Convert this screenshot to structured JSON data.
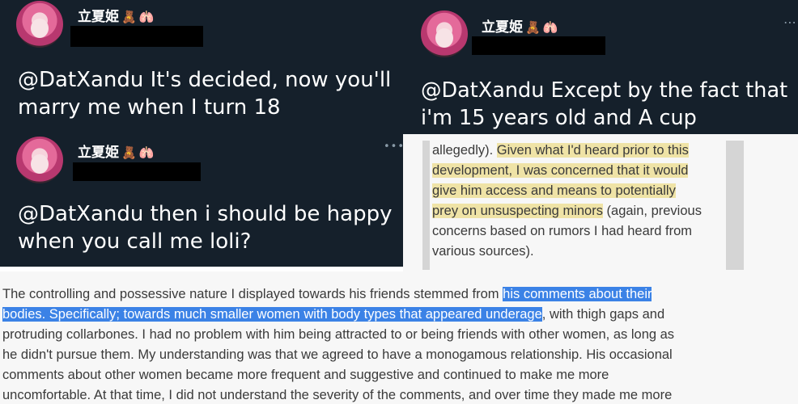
{
  "tweets": [
    {
      "username": "立夏姫",
      "emoji": [
        "🧸",
        "🫁"
      ],
      "text_lines": [
        "@DatXandu It's decided, now you'll",
        "marry me when I turn 18"
      ]
    },
    {
      "username": "立夏姫",
      "emoji": [
        "🧸",
        "🫁"
      ],
      "more": "⋯",
      "text_lines": [
        "@DatXandu Except by the fact that",
        "i'm 15 years old and A cup"
      ]
    },
    {
      "username": "立夏姫",
      "emoji": [
        "🧸",
        "🫁"
      ],
      "more": "•••",
      "text_lines": [
        "@DatXandu then i should be happy",
        "when you call me loli?"
      ]
    }
  ],
  "statement_excerpt": {
    "lines": [
      {
        "plain_before": "allegedly). ",
        "highlight": "Given what I'd heard prior to this",
        "plain_after": ""
      },
      {
        "plain_before": "",
        "highlight": "development, I was concerned that it would",
        "plain_after": ""
      },
      {
        "plain_before": "",
        "highlight": "give him access and means to potentially",
        "plain_after": ""
      },
      {
        "plain_before": "",
        "highlight": "prey on unsuspecting minors",
        "plain_after": " (again, previous"
      },
      {
        "plain_before": "concerns based on rumors I had heard from",
        "highlight": "",
        "plain_after": ""
      },
      {
        "plain_before": "various sources).",
        "highlight": "",
        "plain_after": ""
      }
    ],
    "highlight_color": "#efe3a6"
  },
  "statement_main": {
    "lines": [
      {
        "plain_before": "The controlling and possessive nature I displayed towards his friends stemmed from ",
        "highlight": "his comments about their",
        "plain_after": ""
      },
      {
        "plain_before": "",
        "highlight": "bodies. Specifically; towards much smaller women with body types that appeared underage",
        "plain_after": ", with thigh gaps and"
      },
      {
        "plain_before": "protruding collarbones. I had no problem with him being attracted to or being friends with other women, as long as",
        "highlight": "",
        "plain_after": ""
      },
      {
        "plain_before": "he didn't pursue them. My understanding was that we agreed to have a monogamous relationship. His occasional",
        "highlight": "",
        "plain_after": ""
      },
      {
        "plain_before": "comments about other women became more frequent and suggestive and continued to make me more",
        "highlight": "",
        "plain_after": ""
      },
      {
        "plain_before": "uncomfortable. At that time, I did not understand the severity of the comments, and over time they made me more",
        "highlight": "",
        "plain_after": ""
      }
    ],
    "highlight_color": "#3b82e6"
  }
}
